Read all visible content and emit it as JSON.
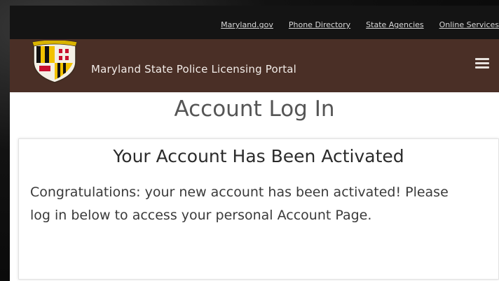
{
  "utility_nav": {
    "links": [
      {
        "label": "Maryland.gov"
      },
      {
        "label": "Phone Directory"
      },
      {
        "label": "State Agencies"
      },
      {
        "label": "Online Services"
      }
    ]
  },
  "header": {
    "title": "Maryland State Police Licensing Portal",
    "logo_icon": "maryland-state-police-badge-icon",
    "menu_icon": "hamburger-menu-icon"
  },
  "main": {
    "page_title": "Account Log In",
    "notice": {
      "heading": "Your Account Has Been Activated",
      "message": "Congratulations: your new account has been activated! Please log in below to access your personal Account Page."
    }
  },
  "colors": {
    "utility_bar": "#141414",
    "header_brown": "#4a2f26",
    "page_background": "#ffffff"
  }
}
